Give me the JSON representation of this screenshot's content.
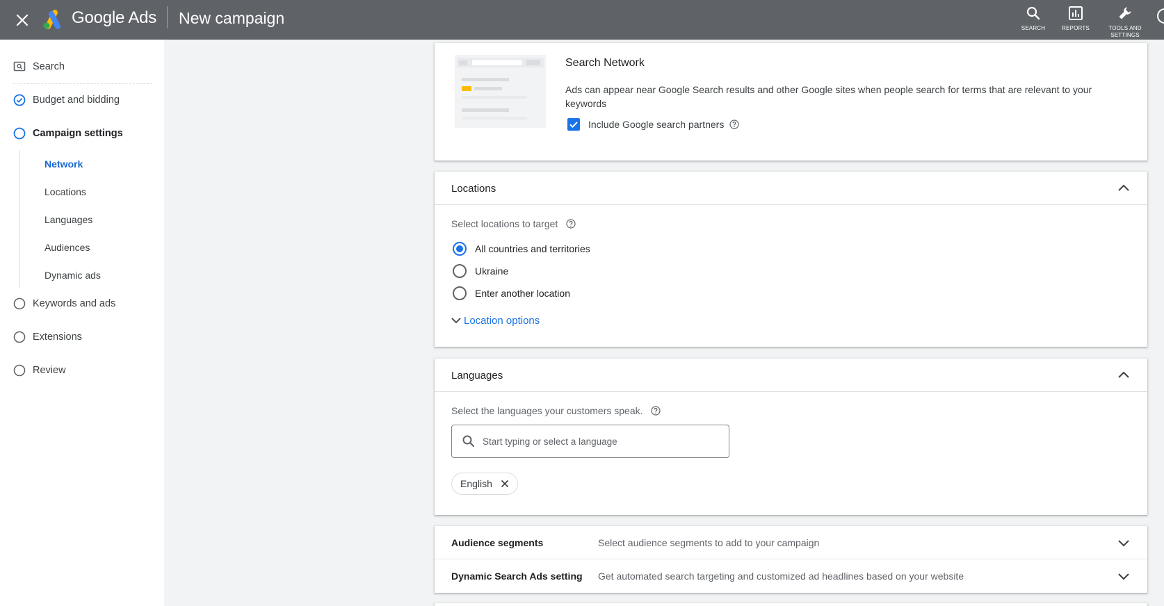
{
  "topbar": {
    "brand": "Google Ads",
    "page_title": "New campaign",
    "buttons": {
      "search": "SEARCH",
      "reports": "REPORTS",
      "tools": "TOOLS AND SETTINGS"
    }
  },
  "sidebar": {
    "items": [
      {
        "label": "Search",
        "icon": "search-box-icon"
      },
      {
        "label": "Budget and bidding",
        "icon": "check-circle-icon"
      },
      {
        "label": "Campaign settings",
        "icon": "circle-icon"
      },
      {
        "label": "Keywords and ads",
        "icon": "circle-icon"
      },
      {
        "label": "Extensions",
        "icon": "circle-icon"
      },
      {
        "label": "Review",
        "icon": "circle-icon"
      }
    ],
    "sub_items": [
      "Network",
      "Locations",
      "Languages",
      "Audiences",
      "Dynamic ads"
    ]
  },
  "search_network": {
    "title": "Search Network",
    "description": "Ads can appear near Google Search results and other Google sites when people search for terms that are relevant to your keywords",
    "checkbox_label": "Include Google search partners",
    "checked": true
  },
  "locations": {
    "title": "Locations",
    "prompt": "Select locations to target",
    "options": [
      "All countries and territories",
      "Ukraine",
      "Enter another location"
    ],
    "selected": "All countries and territories",
    "link": "Location options"
  },
  "languages": {
    "title": "Languages",
    "prompt": "Select the languages your customers speak.",
    "placeholder": "Start typing or select a language",
    "chips": [
      "English"
    ]
  },
  "audience": {
    "title": "Audience segments",
    "description": "Select audience segments to add to your campaign"
  },
  "dsa": {
    "title": "Dynamic Search Ads setting",
    "description": "Get automated search targeting and customized ad headlines based on your website"
  },
  "colors": {
    "topbar": "#5f6368",
    "accent": "#1a73e8",
    "logo_yellow": "#fbbc04",
    "logo_green": "#34a853"
  }
}
